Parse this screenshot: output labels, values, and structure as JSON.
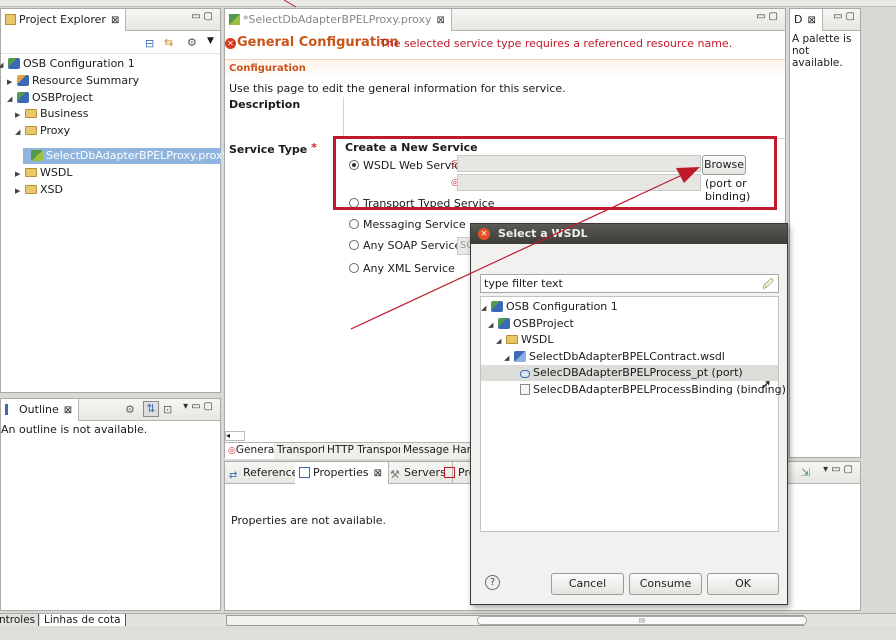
{
  "project_explorer": {
    "title": "Project Explorer",
    "tree": [
      {
        "label": "OSB Configuration 1"
      },
      {
        "label": "Resource Summary"
      },
      {
        "label": "OSBProject"
      },
      {
        "label": "Business"
      },
      {
        "label": "Proxy"
      },
      {
        "label": "SelectDbAdapterBPELProxy.proxy"
      },
      {
        "label": "WSDL"
      },
      {
        "label": "XSD"
      }
    ]
  },
  "outline": {
    "title": "Outline",
    "message": "An outline is not available."
  },
  "editor": {
    "tab_title": "*SelectDbAdapterBPELProxy.proxy",
    "header": "General Configuration",
    "header_error": "The selected service type requires a referenced resource name.",
    "section_title": "Configuration",
    "intro": "Use this page to edit the general information for this service.",
    "description_label": "Description",
    "service_type_label": "Service Type",
    "required_mark": "*",
    "create_label": "Create a New Service",
    "options": {
      "wsdl": "WSDL Web Service",
      "transport": "Transport Typed Service",
      "messaging": "Messaging Service",
      "soap": "Any SOAP Service",
      "xml": "Any XML Service"
    },
    "soap_value": "SO",
    "browse_label": "Browse",
    "port_binding_hint": "(port or binding)",
    "bottom_tabs": [
      "General",
      "Transport",
      "HTTP Transport",
      "Message Handl"
    ]
  },
  "palette": {
    "title": "D",
    "message": "A palette is not available."
  },
  "lower_panel": {
    "tabs": [
      "References",
      "Properties",
      "Servers",
      "Pro"
    ],
    "message": "Properties are not available."
  },
  "bottom_strip": {
    "tabs": [
      "ntroles",
      "Linhas de cota"
    ],
    "scroll_label": "III"
  },
  "dialog": {
    "title": "Select a WSDL",
    "filter_placeholder": "type filter text",
    "tree": [
      {
        "label": "OSB Configuration 1"
      },
      {
        "label": "OSBProject"
      },
      {
        "label": "WSDL"
      },
      {
        "label": "SelectDbAdapterBPELContract.wsdl"
      },
      {
        "label": "SelecDBAdapterBPELProcess_pt (port)"
      },
      {
        "label": "SelecDBAdapterBPELProcessBinding (binding)"
      }
    ],
    "help_label": "?",
    "cancel_label": "Cancel",
    "consume_label": "Consume",
    "ok_label": "OK"
  },
  "colors": {
    "accent_red": "#c0192a",
    "header_orange": "#c9541a",
    "selection_blue": "#8fb5df",
    "dialog_title": "#4a4944"
  }
}
